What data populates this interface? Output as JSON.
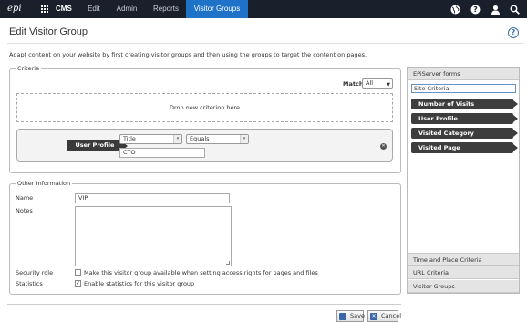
{
  "topbar": {
    "logo": "epi",
    "brand": "CMS",
    "nav": [
      "Edit",
      "Admin",
      "Reports",
      "Visitor Groups"
    ],
    "active_color": "#1e72c8",
    "icons": [
      "globe-icon",
      "help-icon",
      "user-icon",
      "search-icon"
    ]
  },
  "page": {
    "title": "Edit Visitor Group",
    "help": "?",
    "intro": "Adapt content on your website by first creating visitor groups and then using the groups to target the content on pages."
  },
  "criteria": {
    "legend": "Criteria",
    "match_label": "Match",
    "match_value": "All",
    "drop_text": "Drop new criterion here",
    "criterion": {
      "tag": "User Profile",
      "field": "Title",
      "operator": "Equals",
      "value": "CTO"
    }
  },
  "other": {
    "legend": "Other Information",
    "name_label": "Name",
    "name_value": "VIP",
    "notes_label": "Notes",
    "security_label": "Security role",
    "security_text": "Make this visitor group available when setting access rights for pages and files",
    "security_checked": false,
    "stats_label": "Statistics",
    "stats_text": "Enable statistics for this visitor group",
    "stats_checked": true
  },
  "actions": {
    "save": "Save",
    "cancel": "Cancel"
  },
  "panel": {
    "header": "EPiServer forms",
    "search_value": "Site Criteria",
    "items": [
      "Number of Visits",
      "User Profile",
      "Visited Category",
      "Visited Page"
    ],
    "sections": [
      "Time and Place Criteria",
      "URL Criteria",
      "Visitor Groups"
    ]
  }
}
